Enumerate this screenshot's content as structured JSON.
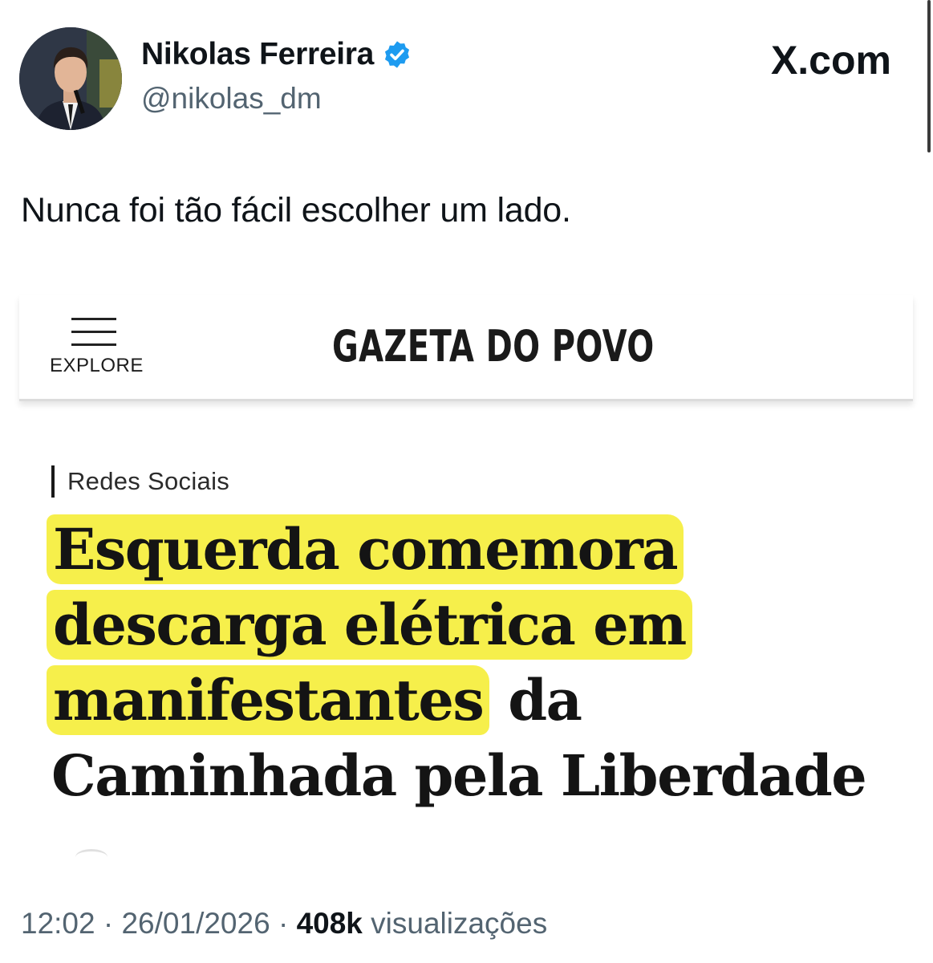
{
  "tweet": {
    "author": {
      "name": "Nikolas Ferreira",
      "handle": "@nikolas_dm",
      "verified": true,
      "verified_icon": "verified-badge-icon",
      "verified_color": "#1d9bf0"
    },
    "site": "X.com",
    "text": "Nunca foi tão fácil escolher um lado.",
    "meta": {
      "time": "12:02",
      "separator": "·",
      "date": "26/01/2026",
      "views_count": "408k",
      "views_label": "visualizações"
    }
  },
  "article": {
    "menu_label": "EXPLORE",
    "menu_icon": "hamburger-menu-icon",
    "logo": "GAZETA DO POVO",
    "section": "Redes Sociais",
    "headline": {
      "line1": "Esquerda comemora",
      "line2": "descarga elétrica em",
      "line3_highlighted": "manifestantes",
      "line3_rest": " da",
      "line4": "Caminhada pela Liberdade"
    },
    "highlight_color": "#f6ef4b"
  }
}
